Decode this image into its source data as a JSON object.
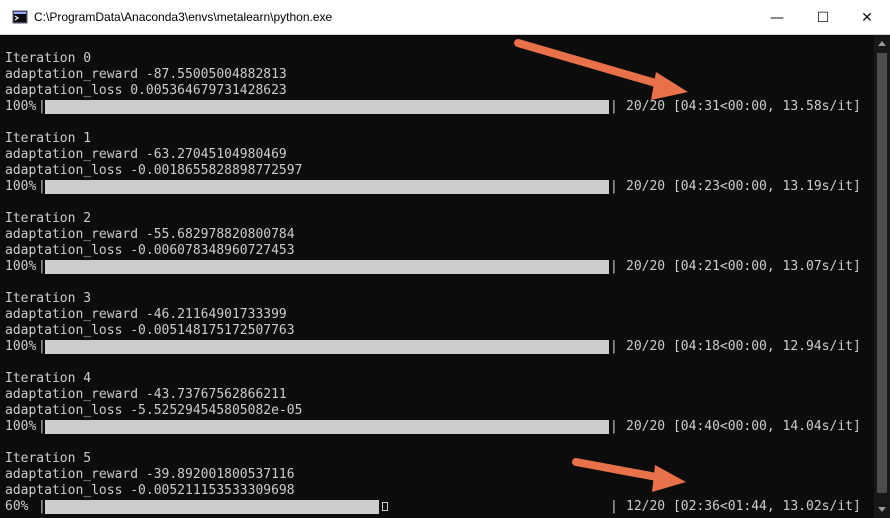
{
  "window": {
    "title": "C:\\ProgramData\\Anaconda3\\envs\\metalearn\\python.exe",
    "minimize_glyph": "—",
    "maximize_glyph": "☐",
    "close_glyph": "✕"
  },
  "colors": {
    "console_bg": "#0c0c0c",
    "console_text": "#cccccc",
    "annotation_arrow": "#e8714a"
  },
  "icons": {
    "app": "console-app-icon",
    "annotation": "arrow-pointer-icon"
  },
  "iterations": [
    {
      "header": "Iteration 0",
      "reward": "adaptation_reward -87.55005004882813",
      "loss": "adaptation_loss 0.005364679731428623",
      "percent": "100%",
      "progress": 1.0,
      "stats": "20/20 [04:31<00:00, 13.58s/it]"
    },
    {
      "header": "Iteration 1",
      "reward": "adaptation_reward -63.27045104980469",
      "loss": "adaptation_loss -0.0018655828898772597",
      "percent": "100%",
      "progress": 1.0,
      "stats": "20/20 [04:23<00:00, 13.19s/it]"
    },
    {
      "header": "Iteration 2",
      "reward": "adaptation_reward -55.682978820800784",
      "loss": "adaptation_loss -0.006078348960727453",
      "percent": "100%",
      "progress": 1.0,
      "stats": "20/20 [04:21<00:00, 13.07s/it]"
    },
    {
      "header": "Iteration 3",
      "reward": "adaptation_reward -46.21164901733399",
      "loss": "adaptation_loss -0.005148175172507763",
      "percent": "100%",
      "progress": 1.0,
      "stats": "20/20 [04:18<00:00, 12.94s/it]"
    },
    {
      "header": "Iteration 4",
      "reward": "adaptation_reward -43.73767562866211",
      "loss": "adaptation_loss -5.525294545805082e-05",
      "percent": "100%",
      "progress": 1.0,
      "stats": "20/20 [04:40<00:00, 14.04s/it]"
    },
    {
      "header": "Iteration 5",
      "reward": "adaptation_reward -39.892001800537116",
      "loss": "adaptation_loss -0.005211153533309698",
      "percent": "60%",
      "progress": 0.6,
      "stats": "12/20 [02:36<01:44, 13.02s/it]"
    }
  ]
}
